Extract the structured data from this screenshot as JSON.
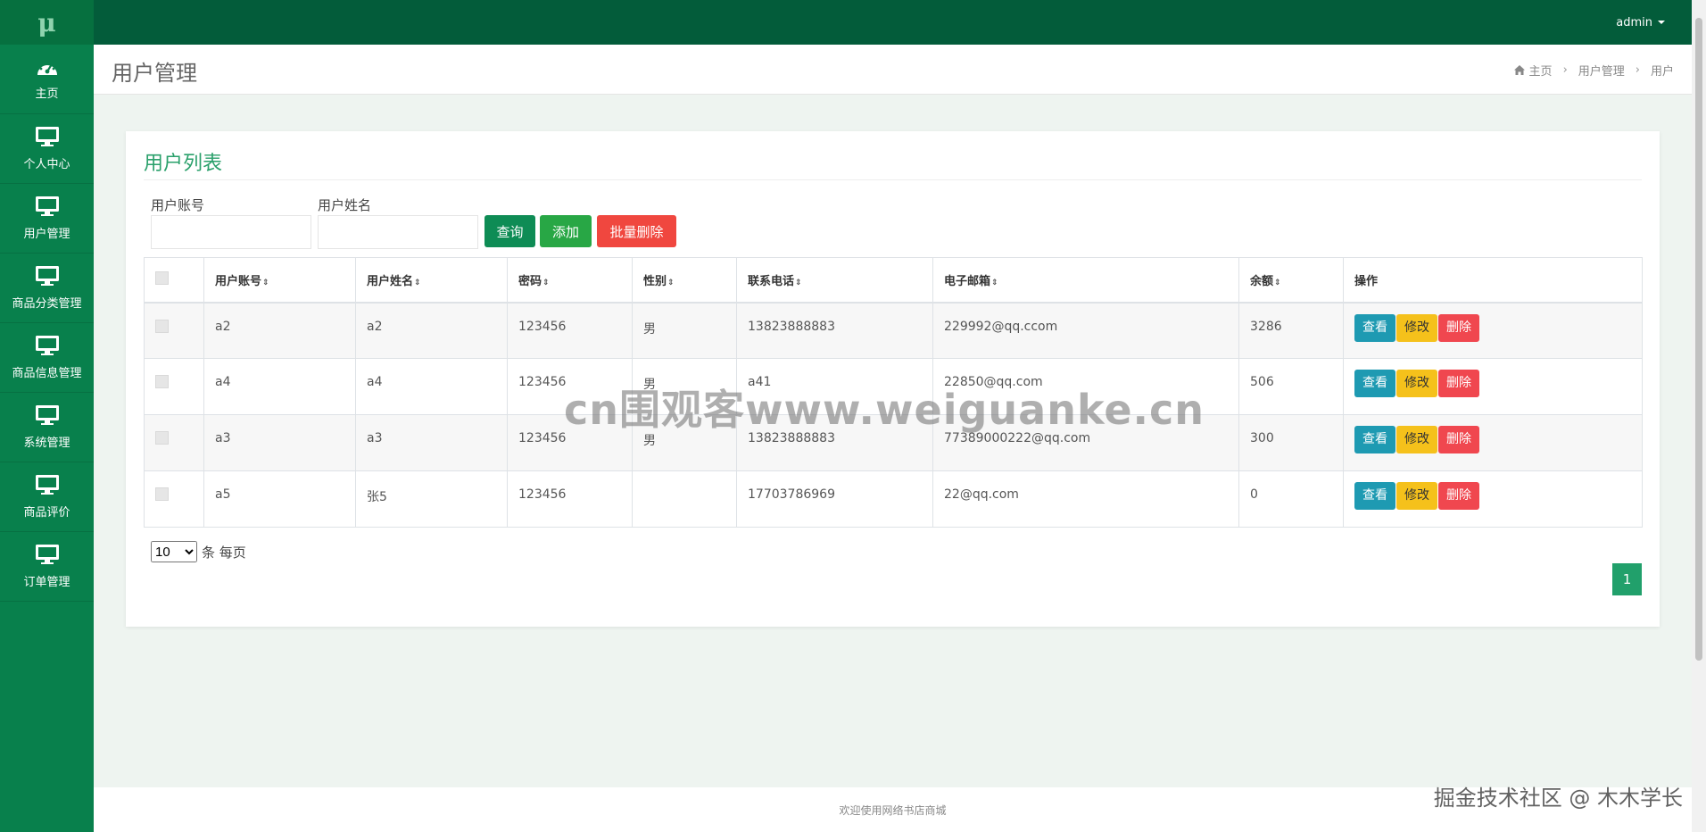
{
  "logo": "μ",
  "sidebar": {
    "items": [
      {
        "label": "主页"
      },
      {
        "label": "个人中心"
      },
      {
        "label": "用户管理"
      },
      {
        "label": "商品分类管理"
      },
      {
        "label": "商品信息管理"
      },
      {
        "label": "系统管理"
      },
      {
        "label": "商品评价"
      },
      {
        "label": "订单管理"
      }
    ]
  },
  "topbar": {
    "user": "admin"
  },
  "header": {
    "title": "用户管理",
    "breadcrumb": [
      "主页",
      "用户管理",
      "用户"
    ]
  },
  "card": {
    "title": "用户列表",
    "search": {
      "account_label": "用户账号",
      "account_value": "",
      "name_label": "用户姓名",
      "name_value": ""
    },
    "buttons": {
      "query": "查询",
      "add": "添加",
      "batch_delete": "批量删除"
    }
  },
  "table": {
    "columns": [
      "用户账号",
      "用户姓名",
      "密码",
      "性别",
      "联系电话",
      "电子邮箱",
      "余额",
      "操作"
    ],
    "rows": [
      {
        "account": "a2",
        "name": "a2",
        "password": "123456",
        "gender": "男",
        "phone": "13823888883",
        "email": "229992@qq.ccom",
        "balance": "3286"
      },
      {
        "account": "a4",
        "name": "a4",
        "password": "123456",
        "gender": "男",
        "phone": "a41",
        "email": "22850@qq.com",
        "balance": "506"
      },
      {
        "account": "a3",
        "name": "a3",
        "password": "123456",
        "gender": "男",
        "phone": "13823888883",
        "email": "77389000222@qq.com",
        "balance": "300"
      },
      {
        "account": "a5",
        "name": "张5",
        "password": "123456",
        "gender": "",
        "phone": "17703786969",
        "email": "22@qq.com",
        "balance": "0"
      }
    ],
    "actions": {
      "view": "查看",
      "edit": "修改",
      "delete": "删除"
    }
  },
  "pagination": {
    "page_size": "10",
    "page_size_suffix": "条 每页",
    "current_page": "1"
  },
  "footer": "欢迎使用网络书店商城",
  "watermarks": {
    "center": "cn围观客www.weiguanke.cn",
    "corner": "掘金技术社区 @ 木木学长"
  },
  "colors": {
    "sidebar": "#08804c",
    "topbar": "#035c3a",
    "accent": "#2aa06b",
    "view": "#1e9ab2",
    "edit": "#f5c11b",
    "delete": "#f0474f"
  }
}
